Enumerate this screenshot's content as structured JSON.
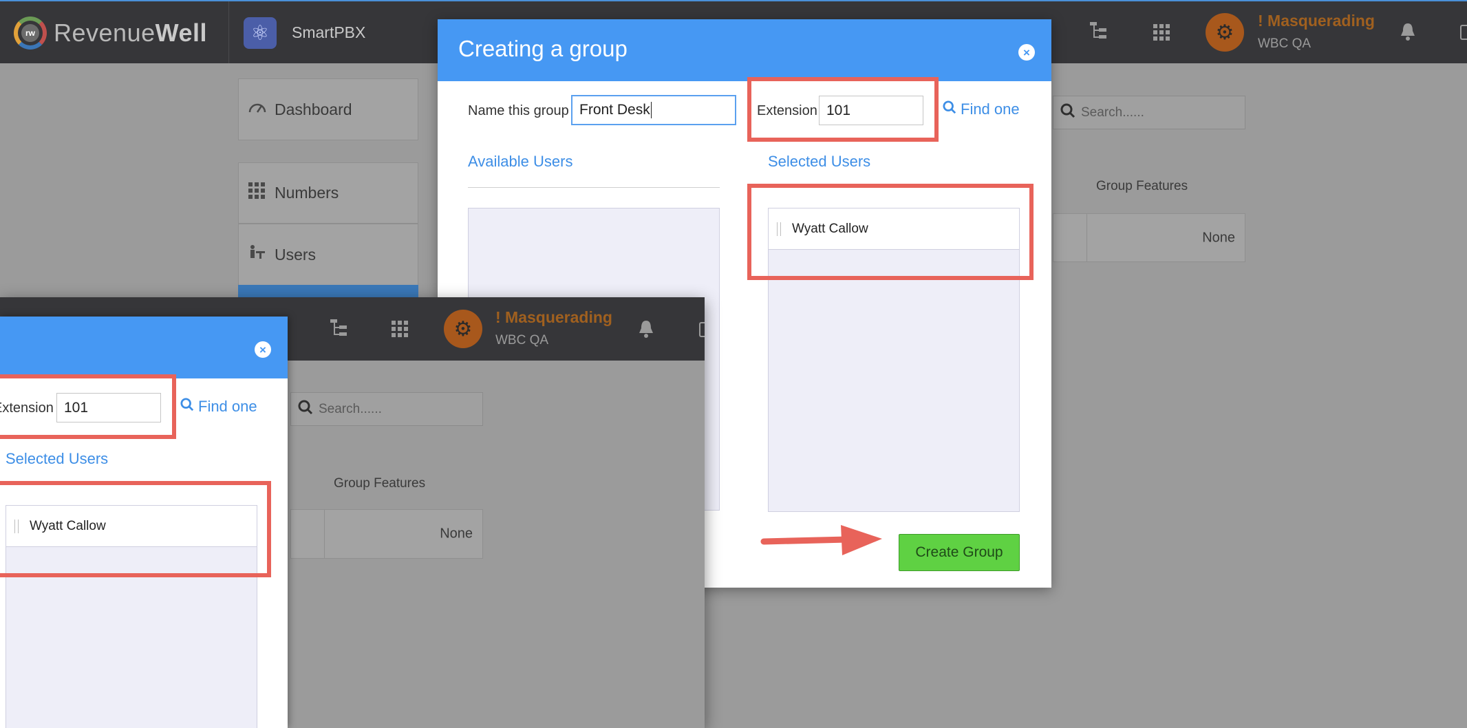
{
  "header": {
    "brand_light": "Revenue",
    "brand_bold": "Well",
    "logo_mark": "rw",
    "app_name": "SmartPBX",
    "masquerade_label": "! Masquerading",
    "account_name": "WBC QA",
    "icons": [
      "atom-icon",
      "org-chart-icon",
      "app-grid-icon",
      "gear-icon",
      "bell-icon"
    ]
  },
  "sidebar": {
    "items": [
      {
        "label": "Dashboard",
        "icon": "speedometer-icon"
      },
      {
        "label": "Numbers",
        "icon": "dial-grid-icon"
      },
      {
        "label": "Users",
        "icon": "users-icon"
      }
    ]
  },
  "background": {
    "search_placeholder": "Search......",
    "column_header": "Group Features",
    "cell_value": "None"
  },
  "modal": {
    "title": "Creating a group",
    "name_label": "Name this group",
    "name_value": "Front Desk",
    "extension_label": "Extension",
    "extension_value": "101",
    "find_link": "Find one",
    "available_heading": "Available Users",
    "selected_heading": "Selected Users",
    "selected_users": [
      "Wyatt Callow"
    ],
    "create_button": "Create Group",
    "close_symbol": "×"
  },
  "inset": {
    "extension_label": "Extension",
    "extension_value": "101",
    "find_link": "Find one",
    "selected_heading": "Selected Users",
    "selected_user": "Wyatt Callow",
    "masquerade_label": "! Masquerading",
    "account_name": "WBC QA",
    "search_placeholder": "Search......",
    "column_header": "Group Features",
    "cell_value": "None",
    "close_symbol": "×"
  },
  "colors": {
    "header_bg": "#363639",
    "modal_header": "#4698f3",
    "link": "#3d8ee6",
    "create_button": "#5fd143",
    "annotation": "#e8635a",
    "masquerade": "#a0601f"
  }
}
